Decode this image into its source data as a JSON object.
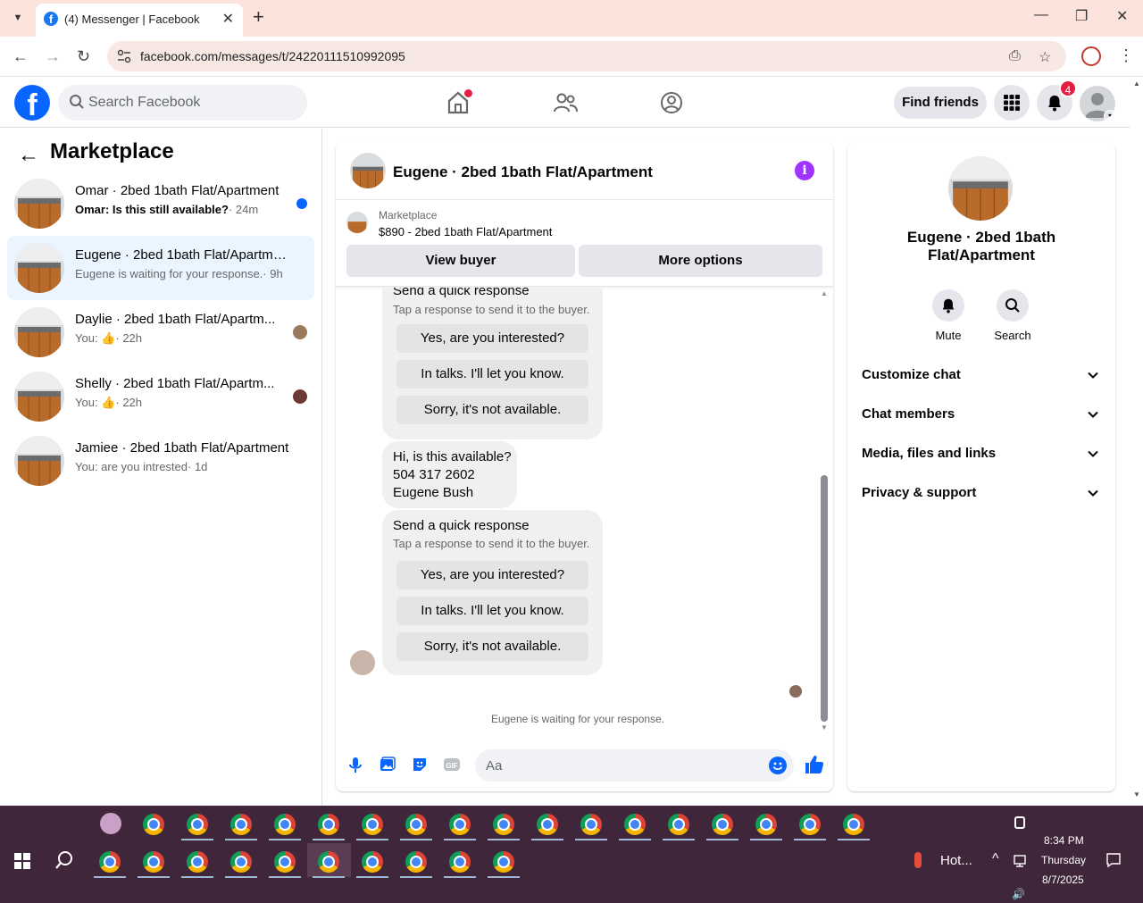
{
  "browser": {
    "tab_title": "(4) Messenger | Facebook",
    "url": "facebook.com/messages/t/24220111510992095"
  },
  "fb_header": {
    "search_placeholder": "Search Facebook",
    "find_friends": "Find friends",
    "notification_count": "4"
  },
  "sidebar": {
    "title": "Marketplace",
    "conversations": [
      {
        "name": "Omar · 2bed 1bath Flat/Apartment",
        "preview": "Omar: Is this still available?",
        "time": "· 24m",
        "unread": true
      },
      {
        "name": "Eugene · 2bed 1bath Flat/Apartment",
        "preview": "Eugene is waiting for your response.",
        "time": "· 9h",
        "active": true
      },
      {
        "name": "Daylie · 2bed 1bath Flat/Apartm...",
        "preview": "You:",
        "time": "· 22h"
      },
      {
        "name": "Shelly · 2bed 1bath Flat/Apartm...",
        "preview": "You:",
        "time": "· 22h"
      },
      {
        "name": "Jamiee · 2bed 1bath Flat/Apartment",
        "preview": "You: are you intrested",
        "time": "· 1d"
      }
    ]
  },
  "chat": {
    "title": "Eugene · 2bed 1bath Flat/Apartment",
    "listing_source": "Marketplace",
    "listing_title": "$890 - 2bed 1bath Flat/Apartment",
    "view_buyer": "View buyer",
    "more_options": "More options",
    "quick_title": "Send a quick response",
    "quick_sub": "Tap a response to send it to the buyer.",
    "quick_options": [
      "Yes, are you interested?",
      "In talks. I'll let you know.",
      "Sorry, it's not available."
    ],
    "message_lines": [
      "Hi, is this available?",
      "504 317 2602",
      "Eugene Bush"
    ],
    "waiting_text": "Eugene is waiting for your response.",
    "composer_placeholder": "Aa"
  },
  "details": {
    "name": "Eugene · 2bed 1bath Flat/Apartment",
    "mute": "Mute",
    "search": "Search",
    "sections": [
      "Customize chat",
      "Chat members",
      "Media, files and links",
      "Privacy & support"
    ]
  },
  "taskbar": {
    "weather": "Hot...",
    "time": "8:34 PM",
    "day": "Thursday",
    "date": "8/7/2025"
  },
  "colors": {
    "fb_blue": "#0866ff",
    "unread_dot": "#0866ff",
    "info_purple": "#a033ff",
    "badge_red": "#e41e3f",
    "tab_bg": "#fce3dc",
    "taskbar": "#40263a"
  }
}
